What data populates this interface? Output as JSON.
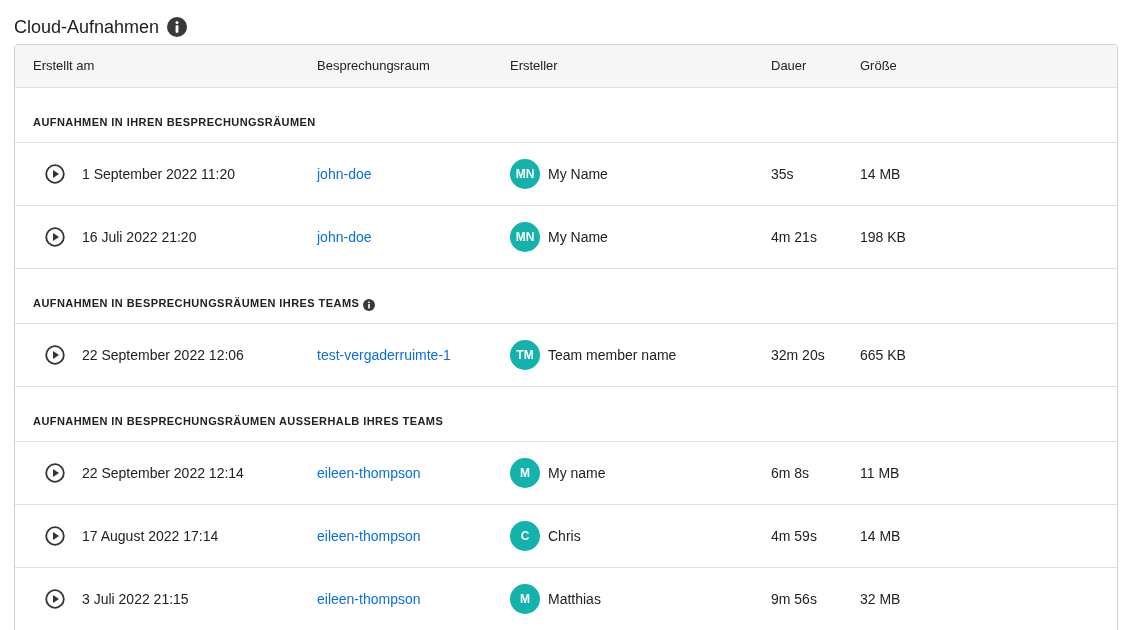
{
  "title": "Cloud-Aufnahmen",
  "title_info": true,
  "columns": [
    "Erstellt am",
    "Besprechungsraum",
    "Ersteller",
    "Dauer",
    "Größe"
  ],
  "groups": [
    {
      "heading": "AUFNAHMEN IN IHREN BESPRECHUNGSRÄUMEN",
      "info": false,
      "rows": [
        {
          "created": "1 September 2022 11:20",
          "room": "john-doe",
          "initials": "MN",
          "creator": "My Name",
          "duration": "35s",
          "size": "14 MB"
        },
        {
          "created": "16 Juli 2022 21:20",
          "room": "john-doe",
          "initials": "MN",
          "creator": "My Name",
          "duration": "4m 21s",
          "size": "198 KB"
        }
      ]
    },
    {
      "heading": "AUFNAHMEN IN BESPRECHUNGSRÄUMEN IHRES TEAMS",
      "info": true,
      "rows": [
        {
          "created": "22 September 2022 12:06",
          "room": "test-vergaderruimte-1",
          "initials": "TM",
          "creator": "Team member name",
          "duration": "32m 20s",
          "size": "665 KB"
        }
      ]
    },
    {
      "heading": "AUFNAHMEN IN BESPRECHUNGSRÄUMEN AUSSERHALB IHRES TEAMS",
      "info": false,
      "rows": [
        {
          "created": "22 September 2022 12:14",
          "room": "eileen-thompson",
          "initials": "M",
          "creator": "My name",
          "duration": "6m 8s",
          "size": "11 MB"
        },
        {
          "created": "17 August 2022 17:14",
          "room": "eileen-thompson",
          "initials": "C",
          "creator": "Chris",
          "duration": "4m 59s",
          "size": "14 MB"
        },
        {
          "created": "3 Juli 2022 21:15",
          "room": "eileen-thompson",
          "initials": "M",
          "creator": "Matthias",
          "duration": "9m 56s",
          "size": "32 MB"
        }
      ]
    }
  ]
}
